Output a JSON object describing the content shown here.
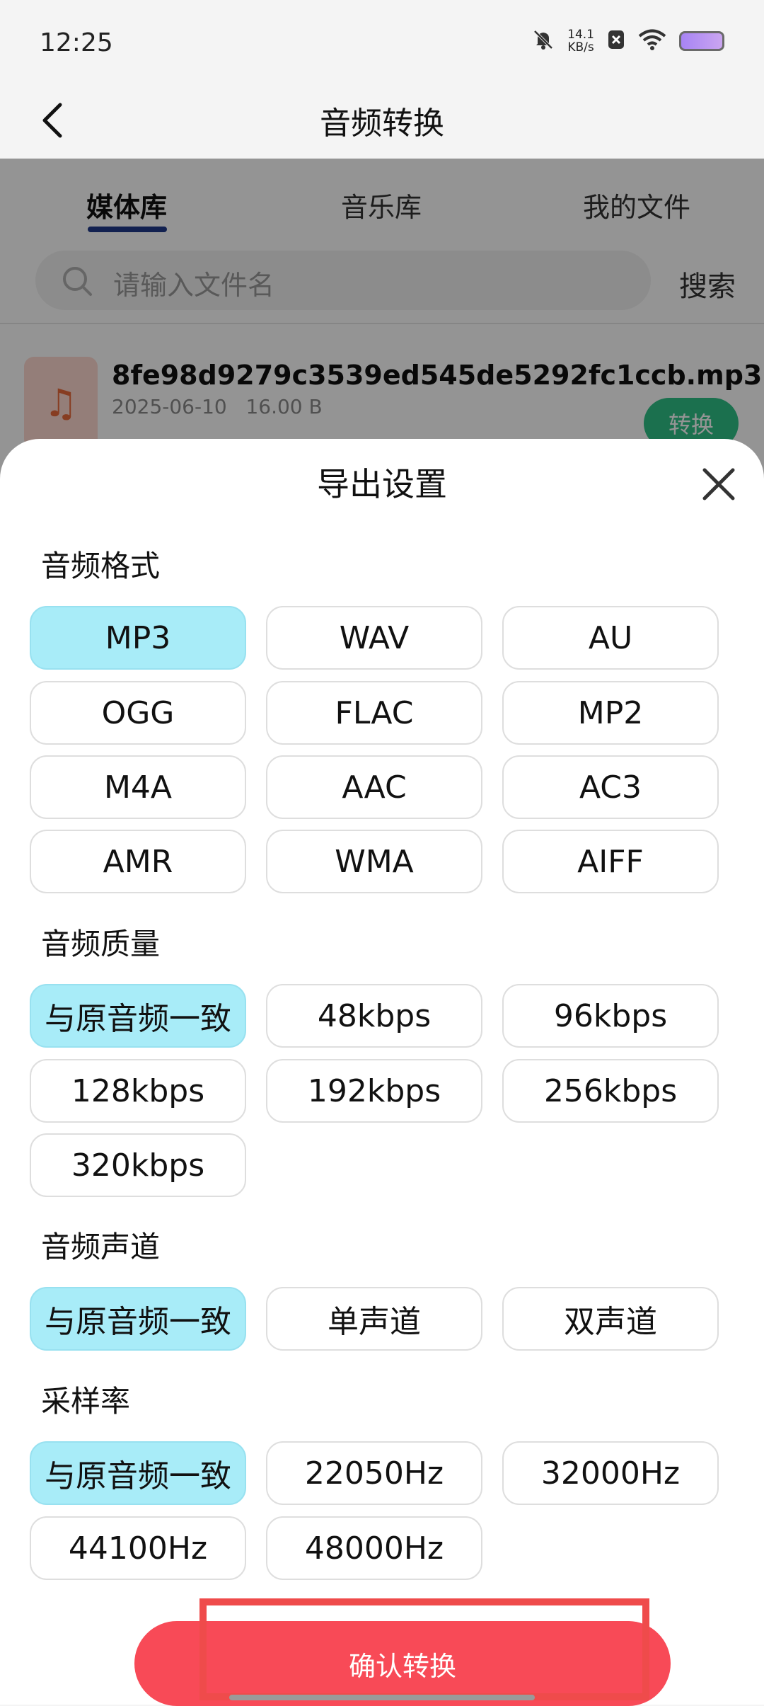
{
  "status_bar": {
    "time": "12:25",
    "net_speed_value": "14.1",
    "net_speed_unit": "KB/s",
    "icons": [
      "mute-icon",
      "data-saver-icon",
      "wifi-icon",
      "battery-icon"
    ]
  },
  "app_bar": {
    "title": "音频转换"
  },
  "tabs": [
    {
      "label": "媒体库",
      "active": true
    },
    {
      "label": "音乐库",
      "active": false
    },
    {
      "label": "我的文件",
      "active": false
    }
  ],
  "search": {
    "placeholder": "请输入文件名",
    "button_label": "搜索"
  },
  "file": {
    "name": "8fe98d9279c3539ed545de5292fc1ccb.mp3",
    "date": "2025-06-10",
    "size": "16.00 B",
    "action_label": "转换",
    "thumb_icon": "♫"
  },
  "sheet": {
    "title": "导出设置",
    "format": {
      "title": "音频格式",
      "options": [
        "MP3",
        "WAV",
        "AU",
        "OGG",
        "FLAC",
        "MP2",
        "M4A",
        "AAC",
        "AC3",
        "AMR",
        "WMA",
        "AIFF"
      ],
      "selected": "MP3"
    },
    "quality": {
      "title": "音频质量",
      "options": [
        "与原音频一致",
        "48kbps",
        "96kbps",
        "128kbps",
        "192kbps",
        "256kbps",
        "320kbps"
      ],
      "selected": "与原音频一致"
    },
    "channel": {
      "title": "音频声道",
      "options": [
        "与原音频一致",
        "单声道",
        "双声道"
      ],
      "selected": "与原音频一致"
    },
    "sample_rate": {
      "title": "采样率",
      "options": [
        "与原音频一致",
        "22050Hz",
        "32000Hz",
        "44100Hz",
        "48000Hz"
      ],
      "selected": "与原音频一致"
    },
    "confirm_label": "确认转换"
  },
  "colors": {
    "selected_option": "#a8ecf8",
    "confirm_button": "#f84a57",
    "highlight": "#ef4b4b",
    "convert_badge": "#2fc287"
  }
}
